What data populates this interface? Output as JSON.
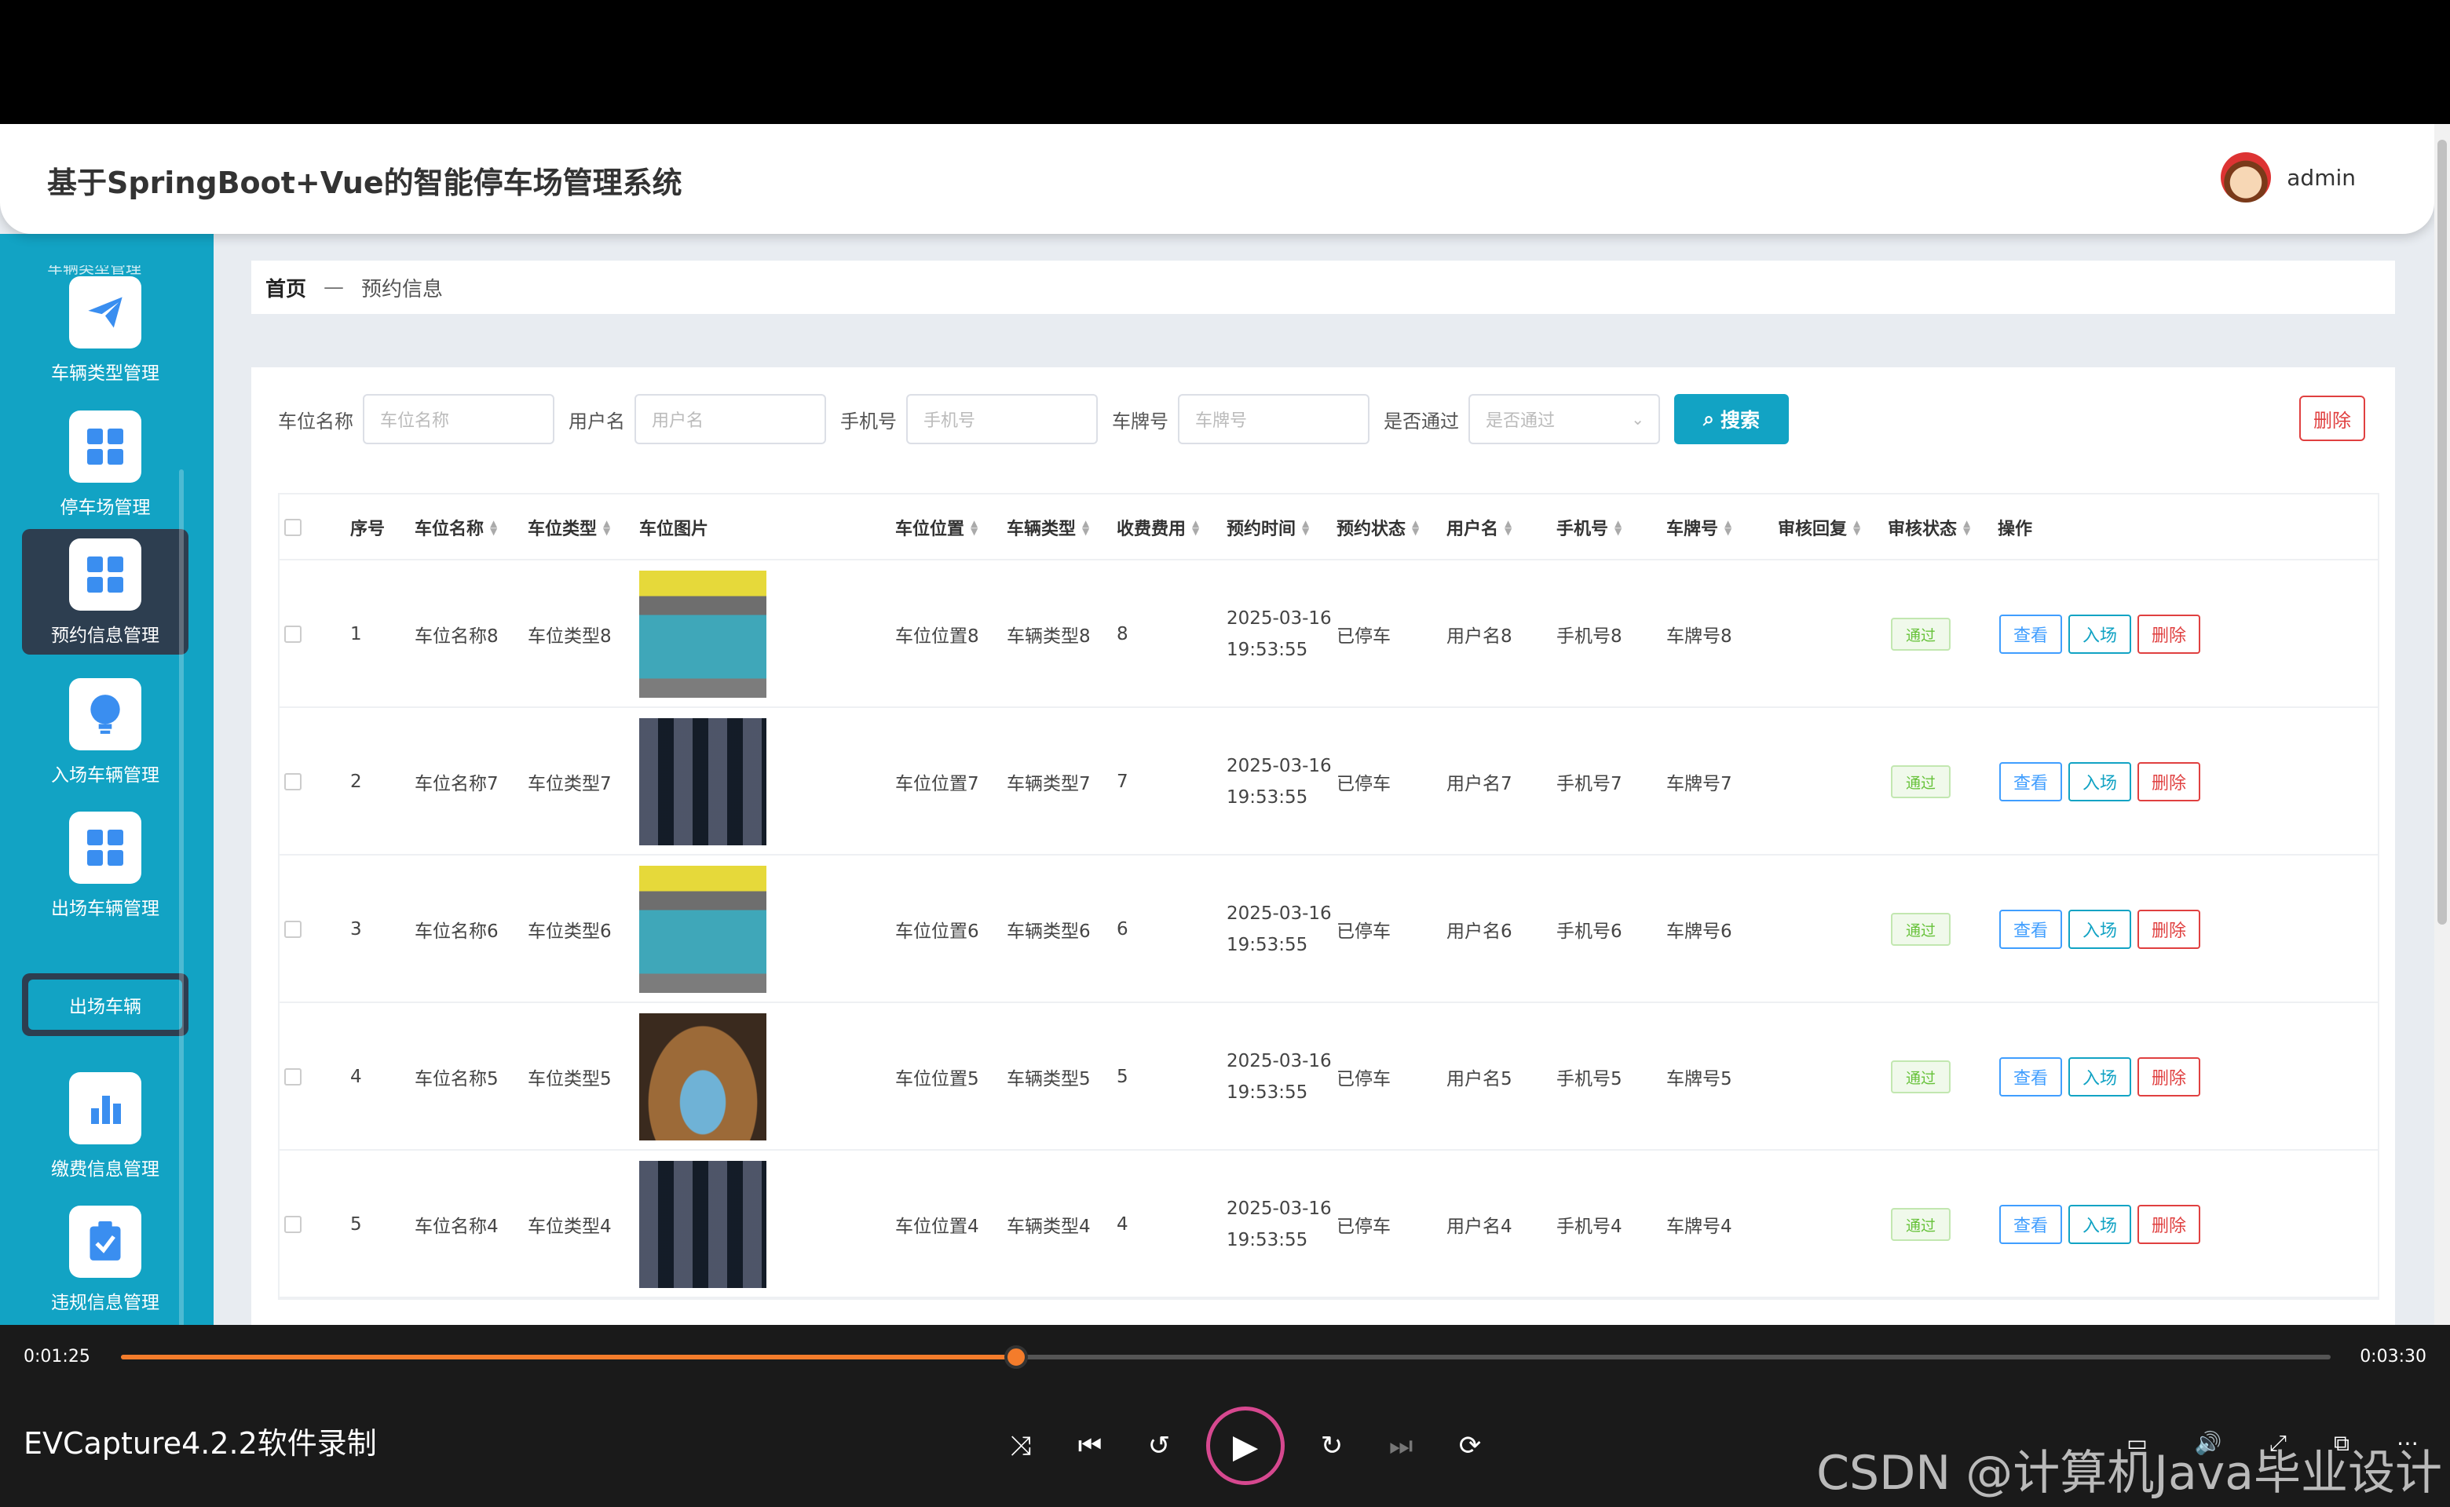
{
  "header": {
    "title": "基于SpringBoot+Vue的智能停车场管理系统",
    "username": "admin"
  },
  "sidebar": {
    "cut_label": "车辆类型管理",
    "items": [
      {
        "label": "车辆类型管理",
        "icon": "paper-plane-icon"
      },
      {
        "label": "停车场管理",
        "icon": "grid-icon"
      },
      {
        "label": "预约信息管理",
        "icon": "grid-icon"
      },
      {
        "label": "入场车辆管理",
        "icon": "lightbulb-icon"
      },
      {
        "label": "出场车辆管理",
        "icon": "grid-icon"
      },
      {
        "label": "缴费信息管理",
        "icon": "bar-chart-icon"
      },
      {
        "label": "违规信息管理",
        "icon": "clipboard-check-icon"
      }
    ],
    "sub_item": "出场车辆"
  },
  "breadcrumb": {
    "home": "首页",
    "sep": "—",
    "current": "预约信息"
  },
  "search": {
    "fields": [
      {
        "label": "车位名称",
        "placeholder": "车位名称"
      },
      {
        "label": "用户名",
        "placeholder": "用户名"
      },
      {
        "label": "手机号",
        "placeholder": "手机号"
      },
      {
        "label": "车牌号",
        "placeholder": "车牌号"
      }
    ],
    "select": {
      "label": "是否通过",
      "placeholder": "是否通过"
    },
    "search_button": "搜索",
    "delete_button": "删除"
  },
  "table": {
    "columns": [
      "序号",
      "车位名称",
      "车位类型",
      "车位图片",
      "车位位置",
      "车辆类型",
      "收费费用",
      "预约时间",
      "预约状态",
      "用户名",
      "手机号",
      "车牌号",
      "审核回复",
      "审核状态",
      "操作"
    ],
    "rows": [
      {
        "no": "1",
        "name": "车位名称8",
        "type": "车位类型8",
        "location": "车位位置8",
        "vehicle_type": "车辆类型8",
        "fee": "8",
        "date": "2025-03-16",
        "time": "19:53:55",
        "status": "已停车",
        "user": "用户名8",
        "phone": "手机号8",
        "plate": "车牌号8",
        "reply": "",
        "audit": "通过"
      },
      {
        "no": "2",
        "name": "车位名称7",
        "type": "车位类型7",
        "location": "车位位置7",
        "vehicle_type": "车辆类型7",
        "fee": "7",
        "date": "2025-03-16",
        "time": "19:53:55",
        "status": "已停车",
        "user": "用户名7",
        "phone": "手机号7",
        "plate": "车牌号7",
        "reply": "",
        "audit": "通过"
      },
      {
        "no": "3",
        "name": "车位名称6",
        "type": "车位类型6",
        "location": "车位位置6",
        "vehicle_type": "车辆类型6",
        "fee": "6",
        "date": "2025-03-16",
        "time": "19:53:55",
        "status": "已停车",
        "user": "用户名6",
        "phone": "手机号6",
        "plate": "车牌号6",
        "reply": "",
        "audit": "通过"
      },
      {
        "no": "4",
        "name": "车位名称5",
        "type": "车位类型5",
        "location": "车位位置5",
        "vehicle_type": "车辆类型5",
        "fee": "5",
        "date": "2025-03-16",
        "time": "19:53:55",
        "status": "已停车",
        "user": "用户名5",
        "phone": "手机号5",
        "plate": "车牌号5",
        "reply": "",
        "audit": "通过"
      },
      {
        "no": "5",
        "name": "车位名称4",
        "type": "车位类型4",
        "location": "车位位置4",
        "vehicle_type": "车辆类型4",
        "fee": "4",
        "date": "2025-03-16",
        "time": "19:53:55",
        "status": "已停车",
        "user": "用户名4",
        "phone": "手机号4",
        "plate": "车牌号4",
        "reply": "",
        "audit": "通过"
      }
    ],
    "actions": {
      "view": "查看",
      "enter": "入场",
      "delete": "删除"
    }
  },
  "player": {
    "current_time": "0:01:25",
    "total_time": "0:03:30",
    "progress": 0.405,
    "recorder_label": "EVCapture4.2.2软件录制",
    "watermark": "CSDN @计算机Java毕业设计"
  },
  "colors": {
    "accent": "#12a3c4",
    "sidebar_active": "#2d3e50",
    "danger": "#e04040",
    "primary": "#409eff",
    "success": "#67c23a",
    "progress": "#f47c2b"
  }
}
